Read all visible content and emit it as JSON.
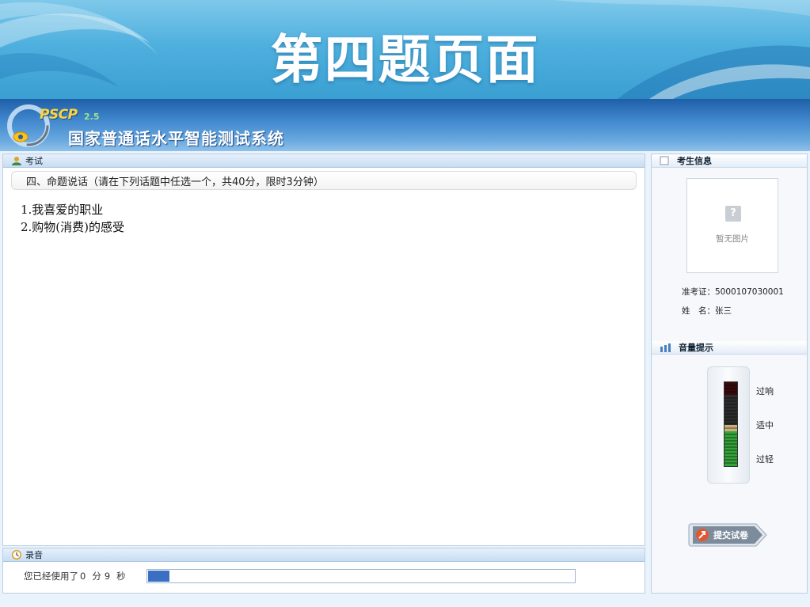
{
  "slide": {
    "title": "第四题页面"
  },
  "app": {
    "logo_text": "PSCP",
    "logo_version": "2.5",
    "name": "国家普通话水平智能测试系统"
  },
  "exam_panel": {
    "tab_label": "考试",
    "question_header": "四、命题说话（请在下列话题中任选一个，共40分，限时3分钟）",
    "topics": [
      "1.我喜爱的职业",
      "2.购物(消费)的感受"
    ]
  },
  "recording_panel": {
    "tab_label": "录音",
    "elapsed_prefix": "您已经使用了",
    "minutes": "0",
    "minute_unit": "分",
    "seconds": "9",
    "second_unit": "秒",
    "progress_fraction": 0.05
  },
  "candidate_panel": {
    "tab_label": "考生信息",
    "photo_placeholder": "暂无图片",
    "photo_icon": "?",
    "ticket_label": "准考证：",
    "ticket_value": "5000107030001",
    "name_label": "姓　名：",
    "name_value": "张三"
  },
  "volume_panel": {
    "tab_label": "音量提示",
    "level_high": "过响",
    "level_mid": "适中",
    "level_low": "过轻"
  },
  "submit": {
    "label": "提交试卷"
  }
}
